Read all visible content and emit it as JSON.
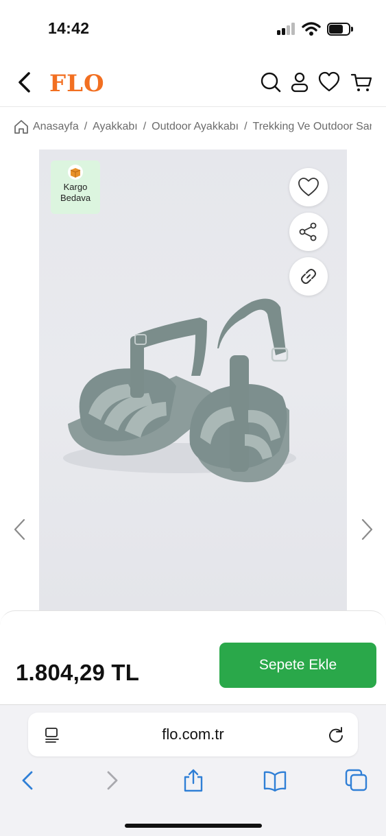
{
  "status_bar": {
    "time": "14:42"
  },
  "header": {
    "logo": "FLO",
    "brand_color": "#f26f21",
    "icons": [
      "back-icon",
      "search-icon",
      "user-icon",
      "heart-icon",
      "cart-icon"
    ]
  },
  "breadcrumb": {
    "items": [
      "Anasayfa",
      "Ayakkabı",
      "Outdoor Ayakkabı",
      "Trekking Ve Outdoor Sandalet"
    ],
    "separator": "/"
  },
  "product": {
    "badge_line1": "Kargo",
    "badge_line2": "Bedava",
    "badge_color": "#dcf5df",
    "action_icons": [
      "heart-icon",
      "share-icon",
      "link-icon"
    ]
  },
  "purchase": {
    "price": "1.804,29 TL",
    "add_to_cart_label": "Sepete Ekle",
    "button_color": "#2aa84a"
  },
  "browser": {
    "url": "flo.com.tr",
    "toolbar_icons": [
      "back-icon",
      "forward-icon",
      "share-icon",
      "bookmarks-icon",
      "tabs-icon"
    ],
    "accent_color": "#2f7fd6"
  }
}
